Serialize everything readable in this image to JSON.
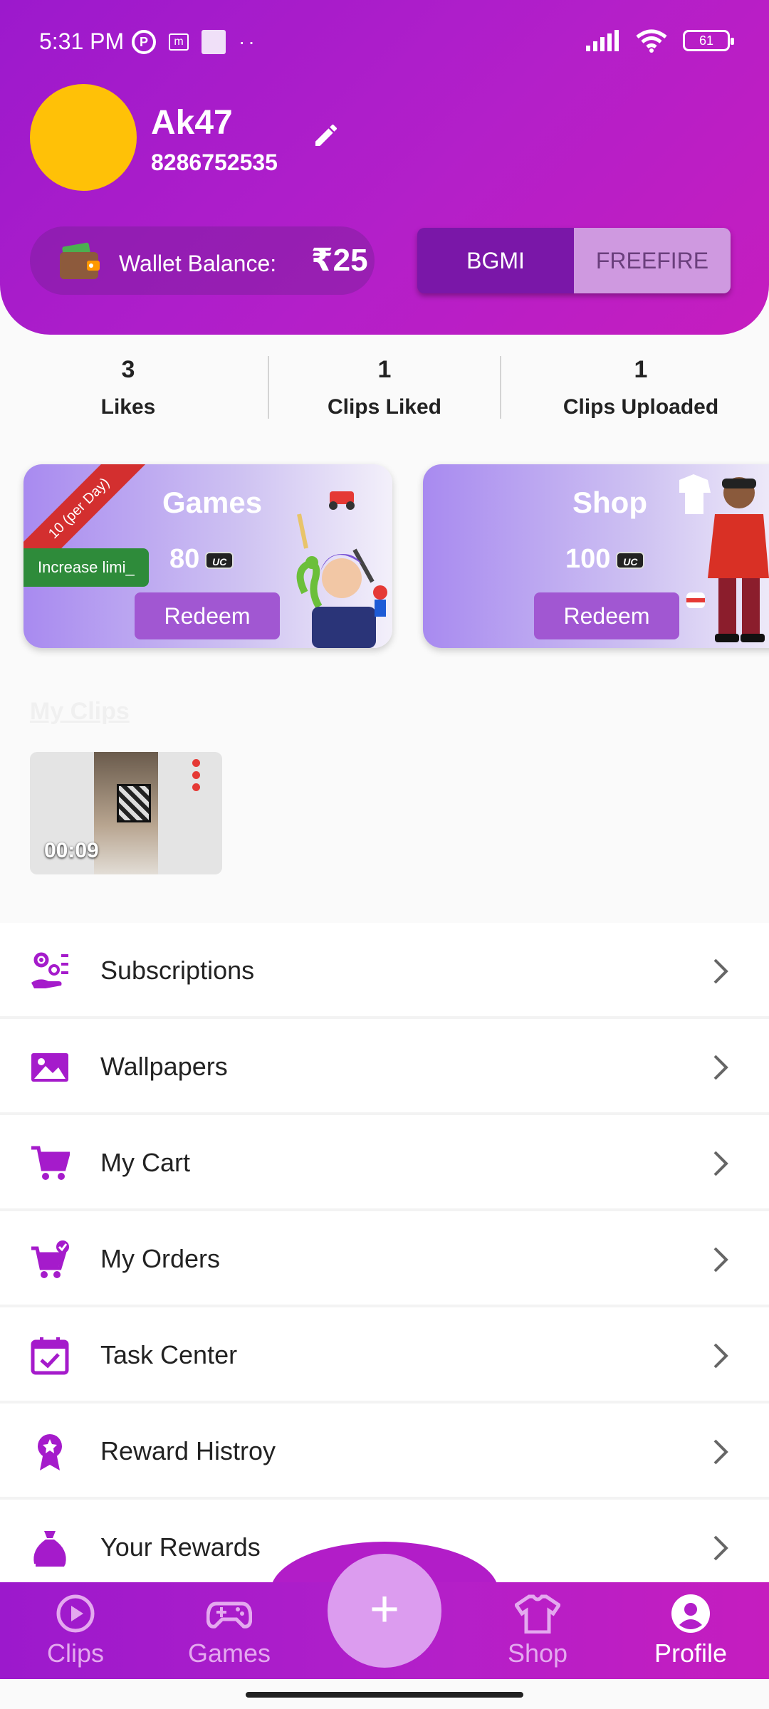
{
  "status": {
    "time": "5:31 PM",
    "battery": "61"
  },
  "profile": {
    "name": "Ak47",
    "phone": "8286752535"
  },
  "wallet": {
    "label": "Wallet Balance: ",
    "amount": "₹25"
  },
  "game_toggle": {
    "options": [
      "BGMI",
      "FREEFIRE"
    ],
    "selected": "FREEFIRE"
  },
  "stats": [
    {
      "value": "3",
      "label": "Likes"
    },
    {
      "value": "1",
      "label": "Clips Liked"
    },
    {
      "value": "1",
      "label": "Clips Uploaded"
    }
  ],
  "cards": {
    "games": {
      "title": "Games",
      "value": "80",
      "uc": "UC",
      "button": "Redeem",
      "ribbon": "10 (per Day)",
      "increase": "Increase limi_"
    },
    "shop": {
      "title": "Shop",
      "value": "100",
      "uc": "UC",
      "button": "Redeem"
    }
  },
  "my_clips": {
    "title": "My Clips",
    "clips": [
      {
        "duration": "00:09"
      }
    ]
  },
  "menu": [
    {
      "label": "Subscriptions",
      "icon": "subscriptions-icon"
    },
    {
      "label": "Wallpapers",
      "icon": "image-icon"
    },
    {
      "label": "My Cart",
      "icon": "cart-icon"
    },
    {
      "label": "My Orders",
      "icon": "cart-check-icon"
    },
    {
      "label": "Task Center",
      "icon": "calendar-check-icon"
    },
    {
      "label": "Reward Histroy",
      "icon": "award-icon"
    },
    {
      "label": "Your Rewards",
      "icon": "money-bag-icon"
    }
  ],
  "nav": {
    "clips": "Clips",
    "games": "Games",
    "add": "+",
    "shop": "Shop",
    "profile": "Profile",
    "active": "Profile"
  },
  "colors": {
    "primary": "#a51bcb",
    "accent": "#ffc107",
    "icon": "#a51bcb"
  }
}
